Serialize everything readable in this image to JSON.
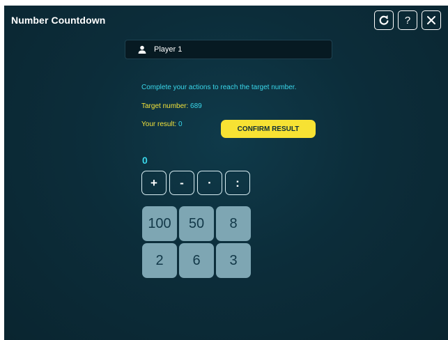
{
  "app": {
    "title": "Number Countdown"
  },
  "toolbar": {
    "restart_icon": "restart-icon",
    "help_label": "?",
    "close_icon": "close-icon"
  },
  "player": {
    "name": "Player 1",
    "icon": "user-icon"
  },
  "game": {
    "instruction": "Complete your actions to reach the target number.",
    "target_label": "Target number:",
    "target_value": "689",
    "result_label": "Your result:",
    "result_value": "0",
    "confirm_label": "CONFIRM RESULT",
    "current_value": "0"
  },
  "operators": [
    "+",
    "-",
    "·",
    ":"
  ],
  "numbers": [
    "100",
    "50",
    "8",
    "2",
    "6",
    "3"
  ],
  "colors": {
    "background": "#0c2d3a",
    "accent_cyan": "#3ad7ea",
    "accent_yellow": "#f2e23a",
    "tile": "#7ea6b3"
  }
}
